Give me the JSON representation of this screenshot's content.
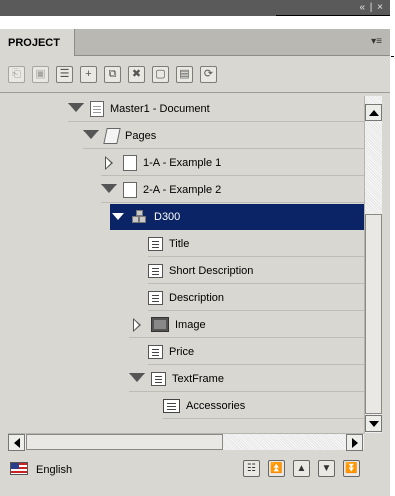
{
  "window": {
    "controls": "« | ×"
  },
  "panel": {
    "tab_label": "PROJECT",
    "menu_glyph": "▾≡"
  },
  "toolbar": {
    "buttons": [
      {
        "icon": "preview-icon",
        "glyph": "⎗",
        "enabled": false
      },
      {
        "icon": "save-icon",
        "glyph": "▣",
        "enabled": false
      },
      {
        "icon": "edit-list-icon",
        "glyph": "☰",
        "enabled": true
      },
      {
        "icon": "add-icon",
        "glyph": "+",
        "enabled": true
      },
      {
        "icon": "duplicate-icon",
        "glyph": "⧉",
        "enabled": true
      },
      {
        "icon": "delete-icon",
        "glyph": "✖",
        "enabled": true
      },
      {
        "icon": "new-page-icon",
        "glyph": "▢",
        "enabled": true
      },
      {
        "icon": "layout-icon",
        "glyph": "▤",
        "enabled": true
      },
      {
        "icon": "refresh-icon",
        "glyph": "⟳",
        "enabled": true
      }
    ]
  },
  "tree": {
    "items": [
      {
        "label": "Master1 - Document",
        "icon": "document-icon",
        "expanded": true,
        "depth": 0
      },
      {
        "label": "Pages",
        "icon": "pages-icon",
        "expanded": true,
        "depth": 1
      },
      {
        "label": "1-A - Example 1",
        "icon": "page-icon",
        "expanded": false,
        "depth": 2
      },
      {
        "label": "2-A - Example 2",
        "icon": "page-icon",
        "expanded": true,
        "depth": 2
      },
      {
        "label": "D300",
        "icon": "product-icon",
        "expanded": true,
        "depth": 3,
        "selected": true
      },
      {
        "label": "Title",
        "icon": "text-field-icon",
        "depth": 4
      },
      {
        "label": "Short Description",
        "icon": "text-field-icon",
        "depth": 4
      },
      {
        "label": "Description",
        "icon": "text-field-icon",
        "depth": 4
      },
      {
        "label": "Image",
        "icon": "image-field-icon",
        "expanded": false,
        "depth": 4
      },
      {
        "label": "Price",
        "icon": "text-field-icon",
        "depth": 4
      },
      {
        "label": "TextFrame",
        "icon": "text-field-icon",
        "expanded": true,
        "depth": 4
      },
      {
        "label": "Accessories",
        "icon": "text-frame-icon",
        "depth": 5
      }
    ]
  },
  "footer": {
    "language": "English",
    "language_flag": "us-flag-icon",
    "nav_buttons": [
      {
        "icon": "hierarchy-icon",
        "glyph": "☷"
      },
      {
        "icon": "first-icon",
        "glyph": "⏫"
      },
      {
        "icon": "previous-icon",
        "glyph": "▲"
      },
      {
        "icon": "next-icon",
        "glyph": "▼"
      },
      {
        "icon": "last-icon",
        "glyph": "⏬"
      }
    ]
  },
  "colors": {
    "selection": "#0a2465",
    "panel_bg": "#d8d7d1",
    "titlebar": "#5a5a5a"
  }
}
